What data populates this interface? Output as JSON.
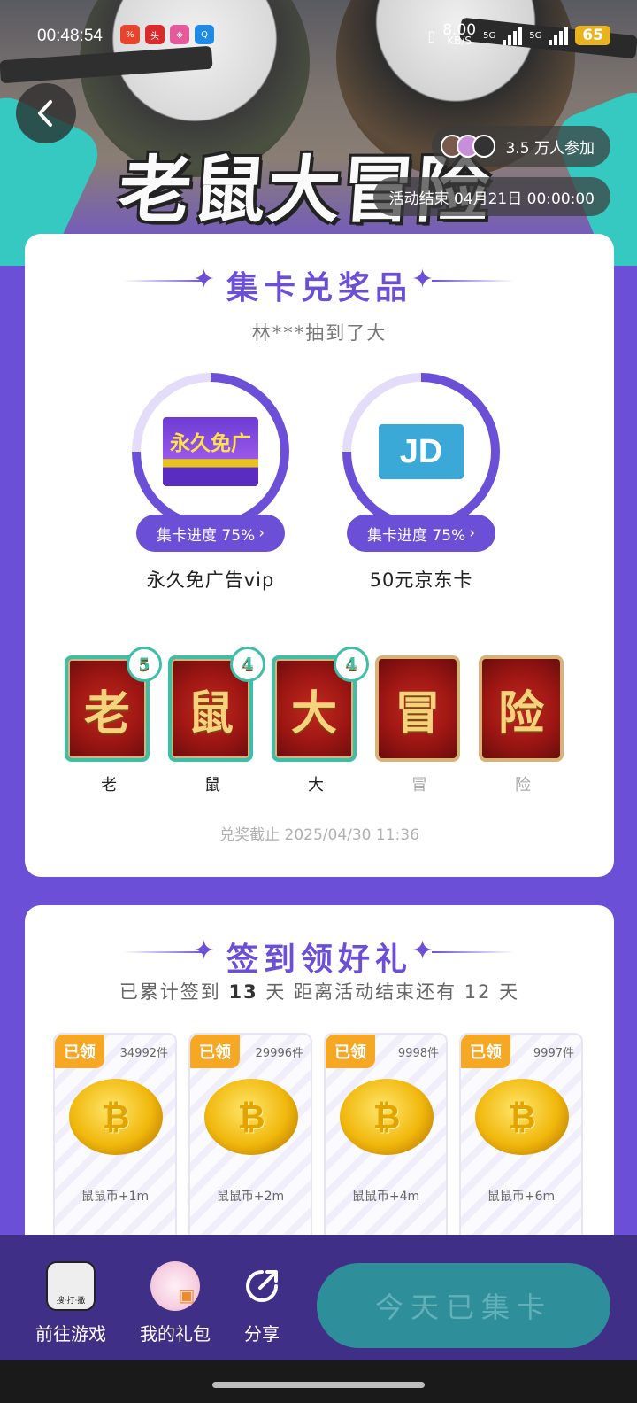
{
  "status_bar": {
    "time": "00:48:54",
    "net_speed_value": "8.00",
    "net_speed_unit": "KB/S",
    "network_1": "5G",
    "network_2": "5G",
    "battery": "65"
  },
  "banner": {
    "title": "老鼠大冒险",
    "participants": "3.5 万人参加",
    "end_time": "活动结束 04月21日 00:00:00"
  },
  "collect_section": {
    "title": "集卡兑奖品",
    "ticker": "林***抽到了大",
    "prizes": [
      {
        "name": "永久免广告vip",
        "image_text": "永久免广",
        "progress_label": "集卡进度 75%",
        "progress": 0.75
      },
      {
        "name": "50元京东卡",
        "image_text": "JD",
        "progress_label": "集卡进度 75%",
        "progress": 0.75
      }
    ],
    "cards": [
      {
        "char": "老",
        "label": "老",
        "count": "5",
        "owned": true
      },
      {
        "char": "鼠",
        "label": "鼠",
        "count": "4",
        "owned": true
      },
      {
        "char": "大",
        "label": "大",
        "count": "4",
        "owned": true
      },
      {
        "char": "冒",
        "label": "冒",
        "count": "",
        "owned": false
      },
      {
        "char": "险",
        "label": "险",
        "count": "",
        "owned": false
      }
    ],
    "deadline": "兑奖截止 2025/04/30 11:36"
  },
  "signin_section": {
    "title": "签到领好礼",
    "subtitle_prefix": "已累计签到",
    "days_signed": "13",
    "subtitle_suffix": "天  距离活动结束还有 12 天",
    "rewards": [
      {
        "tag": "已领",
        "count": "34992件",
        "name": "鼠鼠币+1m"
      },
      {
        "tag": "已领",
        "count": "29996件",
        "name": "鼠鼠币+2m"
      },
      {
        "tag": "已领",
        "count": "9998件",
        "name": "鼠鼠币+4m"
      },
      {
        "tag": "已领",
        "count": "9997件",
        "name": "鼠鼠币+6m"
      }
    ]
  },
  "bottom_bar": {
    "goto_game": "前往游戏",
    "game_icon_text": "搜·打·撒",
    "my_gifts": "我的礼包",
    "share": "分享",
    "collect_button": "今天已集卡"
  },
  "colors": {
    "primary": "#6b4fd6",
    "accent_teal": "#3dbfa7",
    "tag_orange": "#f6a723",
    "button_teal": "#2e8f9a"
  }
}
